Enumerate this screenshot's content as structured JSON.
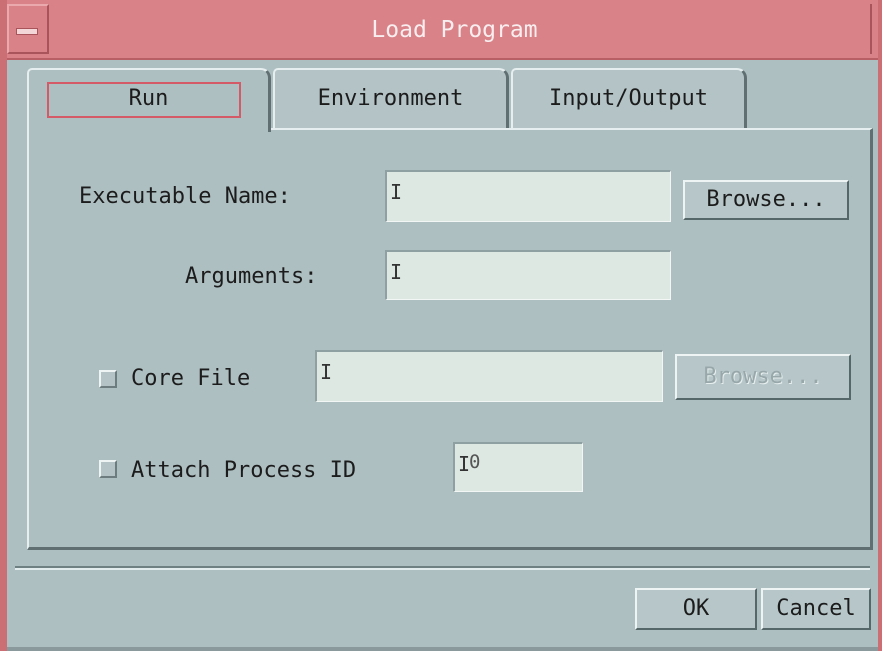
{
  "window": {
    "title": "Load Program"
  },
  "tabs": [
    {
      "label": "Run",
      "active": true
    },
    {
      "label": "Environment",
      "active": false
    },
    {
      "label": "Input/Output",
      "active": false
    }
  ],
  "run": {
    "executable": {
      "label": "Executable Name:",
      "value": "",
      "browse": "Browse..."
    },
    "arguments": {
      "label": "Arguments:",
      "value": ""
    },
    "core_file": {
      "label": "Core File",
      "checked": false,
      "value": "",
      "browse": "Browse...",
      "browse_enabled": false
    },
    "attach": {
      "label": "Attach Process ID",
      "checked": false,
      "value": "0"
    }
  },
  "footer": {
    "ok": "OK",
    "cancel": "Cancel"
  },
  "icons": {
    "window_menu": "window-menu-icon",
    "text_cursor": "I"
  },
  "colors": {
    "title_bar": "#d98288",
    "dialog_background": "#aebfc2",
    "field_background": "#dde8e3",
    "focus_ring": "#d35a66"
  }
}
